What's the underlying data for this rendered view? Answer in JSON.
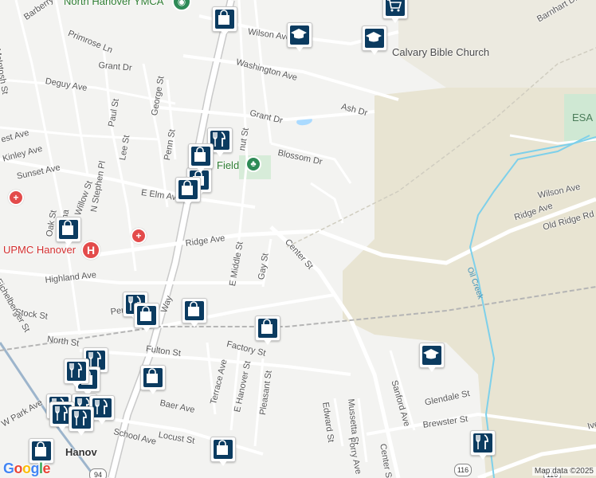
{
  "map": {
    "streets": [
      "Barberry Dr",
      "Primrose Ln",
      "Wilson Ave",
      "Washington Ave",
      "Grant Dr",
      "Deguy Ave",
      "Grant Dr",
      "Ash Dr",
      "Paul St",
      "George St",
      "Blossom Dr",
      "Penn St",
      "est Ave",
      "Kinley Ave",
      "Sunset Ave",
      "N Stephen Pl",
      "Lee St",
      "Willow St",
      "E Elm Ave",
      "Wilson Ave",
      "Ridge Ave",
      "Old Ridge Rd",
      "Cha",
      "Oak St",
      "Ridge Ave",
      "E Middle St",
      "Gay St",
      "Center St",
      "Highland Ave",
      "Eichelberger St",
      "Stock St",
      "North St",
      "Fulton St",
      "Factory St",
      "Terrace Ave",
      "E Hanover St",
      "Pleasant St",
      "Baer Ave",
      "Sanford Ave",
      "Glendale St",
      "Edward St",
      "Mussetta St",
      "Brewster St",
      "W Park Ave",
      "School Ave",
      "Locust St",
      "Forry Ave",
      "Center St",
      "Barnhart Dr",
      "Pen",
      "Hanov",
      "McIntosh St",
      "nut St",
      "Way",
      "Ive"
    ],
    "places": {
      "ymca": "North Hanover YMCA",
      "church": "Calvary Bible Church",
      "hospital": "UPMC Hanover",
      "park": "Field",
      "creek": "Oil Creek",
      "esa": "ESA"
    },
    "route_shields": [
      "94",
      "116",
      "116"
    ],
    "markers": [
      {
        "type": "shopping-bag"
      },
      {
        "type": "shopping-bag"
      },
      {
        "type": "school"
      },
      {
        "type": "school"
      },
      {
        "type": "shopping-cart"
      },
      {
        "type": "restaurant"
      },
      {
        "type": "shopping-bag"
      },
      {
        "type": "shopping-bag"
      },
      {
        "type": "shopping-bag"
      },
      {
        "type": "restaurant"
      },
      {
        "type": "shopping-bag"
      },
      {
        "type": "shopping-bag"
      },
      {
        "type": "shopping-bag"
      },
      {
        "type": "school"
      },
      {
        "type": "restaurant"
      },
      {
        "type": "shopping-bag"
      },
      {
        "type": "shopping-bag"
      },
      {
        "type": "restaurant"
      },
      {
        "type": "restaurant"
      },
      {
        "type": "restaurant"
      },
      {
        "type": "restaurant"
      },
      {
        "type": "restaurant"
      },
      {
        "type": "restaurant"
      },
      {
        "type": "shopping-bag"
      },
      {
        "type": "shopping-bag"
      },
      {
        "type": "restaurant"
      }
    ],
    "attribution": "Map data ©2025",
    "logo": "Google"
  },
  "colors": {
    "marker_fill": "#0b3b60",
    "road": "#ffffff",
    "rail": "#b5b5b5",
    "creek": "#7ed0ea",
    "farmland": "#e8e4d2",
    "park": "#cfe8d3",
    "hospital": "#e34b4b"
  }
}
